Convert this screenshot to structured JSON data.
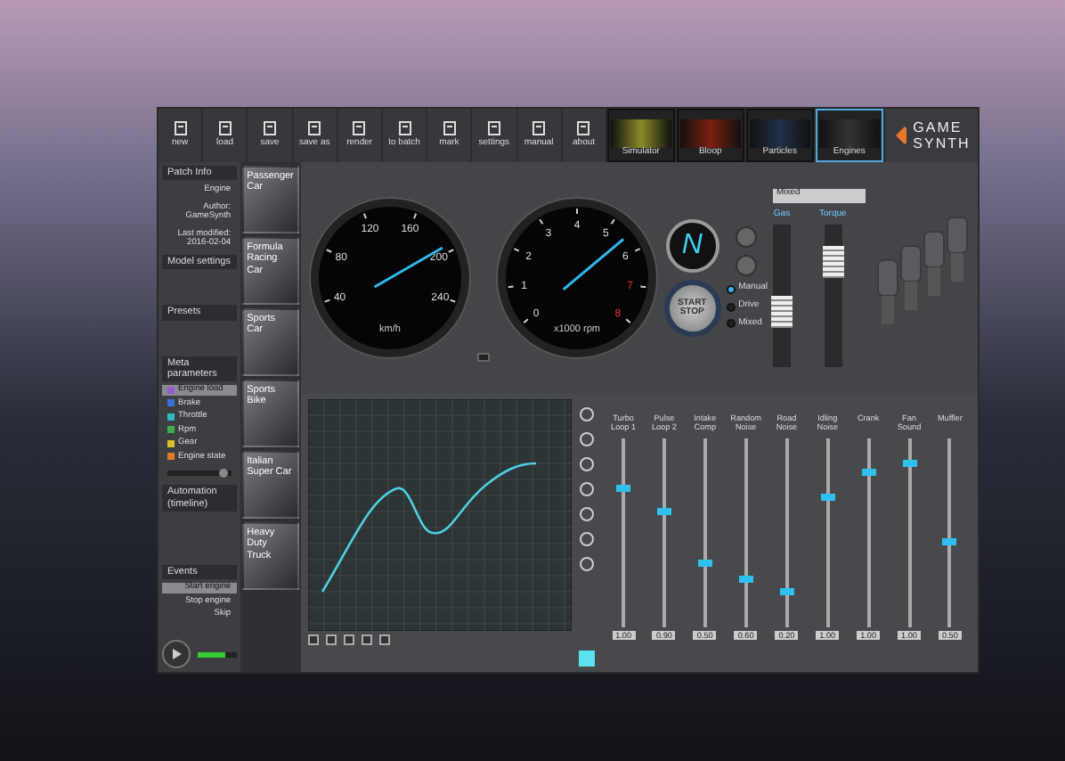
{
  "toolbar": {
    "buttons": [
      {
        "label": "new"
      },
      {
        "label": "load"
      },
      {
        "label": "save"
      },
      {
        "label": "save as"
      },
      {
        "label": "render"
      },
      {
        "label": "to batch"
      },
      {
        "label": "mark"
      },
      {
        "label": "settings"
      },
      {
        "label": "manual"
      },
      {
        "label": "about"
      }
    ],
    "thumbnails": [
      {
        "label": "Simulator",
        "selected": false
      },
      {
        "label": "Bloop",
        "selected": false
      },
      {
        "label": "Particles",
        "selected": false
      },
      {
        "label": "Engines",
        "selected": true
      }
    ],
    "brand": "GAME SYNTH"
  },
  "left_panel": {
    "sections": [
      {
        "title": "Patch Info",
        "lines": [
          "Engine",
          "Author: GameSynth",
          "Last modified: 2016-02-04"
        ]
      },
      {
        "title": "Model settings"
      },
      {
        "title": "Presets"
      },
      {
        "title": "Meta parameters",
        "items": [
          {
            "label": "Engine load",
            "color": "#9b59d0",
            "selected": true
          },
          {
            "label": "Brake",
            "color": "#3f6fd8",
            "selected": false
          },
          {
            "label": "Throttle",
            "color": "#2fb8c8",
            "selected": false
          },
          {
            "label": "Rpm",
            "color": "#3fae4a",
            "selected": false
          },
          {
            "label": "Gear",
            "color": "#d8c22a",
            "selected": false
          },
          {
            "label": "Engine state",
            "color": "#e07a2a",
            "selected": false
          }
        ],
        "slider": {
          "level": 0.95
        }
      },
      {
        "title": "Automation (timeline)"
      },
      {
        "title": "Events",
        "events": [
          {
            "label": "Start engine",
            "selected": true
          },
          {
            "label": "Stop engine",
            "selected": false
          },
          {
            "label": "Skip",
            "selected": false
          }
        ]
      }
    ]
  },
  "gallery": [
    {
      "label": "Passenger Car",
      "selected": false
    },
    {
      "label": "Formula Racing Car",
      "selected": false
    },
    {
      "label": "Sports Car",
      "selected": false
    },
    {
      "label": "Sports Bike",
      "selected": false
    },
    {
      "label": "Italian Super Car",
      "selected": false
    },
    {
      "label": "Heavy Duty Truck",
      "selected": false
    }
  ],
  "dashboard": {
    "speedometer": {
      "unit": "km/h",
      "ticks": [
        "40",
        "80",
        "120",
        "160",
        "200",
        "240"
      ]
    },
    "tachometer": {
      "unit": "x1000 rpm",
      "ticks": [
        "0",
        "1",
        "2",
        "3",
        "4",
        "5",
        "6",
        "7",
        "8"
      ]
    },
    "toggle": {
      "on": false
    },
    "gear": "N",
    "start_button": "START STOP",
    "modes": [
      {
        "label": "Manual",
        "selected": true
      },
      {
        "label": "Drive",
        "selected": false
      },
      {
        "label": "Mixed",
        "selected": false
      }
    ],
    "dropdown": "Mixed",
    "vertical_sliders": [
      {
        "label": "Gas",
        "level": 0.35
      },
      {
        "label": "Torque",
        "level": 0.8
      }
    ]
  },
  "mixer": {
    "sliders": [
      {
        "label": "Turbo Loop 1",
        "level": 0.75,
        "reading": "1.00"
      },
      {
        "label": "Pulse Loop 2",
        "level": 0.62,
        "reading": "0.90"
      },
      {
        "label": "Intake Comp",
        "level": 0.33,
        "reading": "0.50"
      },
      {
        "label": "Random Noise",
        "level": 0.25,
        "reading": "0.60"
      },
      {
        "label": "Road Noise",
        "level": 0.18,
        "reading": "0.20"
      },
      {
        "label": "Idling Noise",
        "level": 0.7,
        "reading": "1.00"
      },
      {
        "label": "Crank",
        "level": 0.83,
        "reading": "1.00"
      },
      {
        "label": "Fan Sound",
        "level": 0.88,
        "reading": "1.00"
      },
      {
        "label": "Muffler",
        "level": 0.45,
        "reading": "0.50"
      }
    ]
  }
}
